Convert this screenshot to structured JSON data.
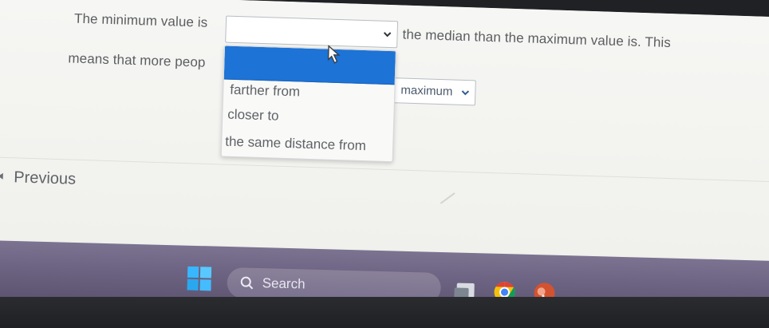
{
  "question": {
    "part1": "The minimum value is",
    "part2": "the median than the maximum value is. This",
    "part3": "means that more peop"
  },
  "primary_select": {
    "current_value": "",
    "options": [
      "farther from",
      "closer to",
      "the same distance from"
    ]
  },
  "secondary_select": {
    "current_value": "maximum"
  },
  "navigation": {
    "previous_label": "Previous"
  },
  "taskbar": {
    "search_label": "Search"
  },
  "colors": {
    "dropdown_highlight": "#1d73d6",
    "text_gray": "#5b5d60",
    "taskbar_purple": "#6d6483"
  },
  "icons": {
    "windows_start": "windows-start-icon",
    "search": "search-icon",
    "file_explorer": "file-explorer-icon",
    "chrome": "chrome-icon",
    "powerpoint": "powerpoint-icon",
    "chevron": "chevron-down-icon",
    "cursor": "mouse-cursor-icon"
  }
}
